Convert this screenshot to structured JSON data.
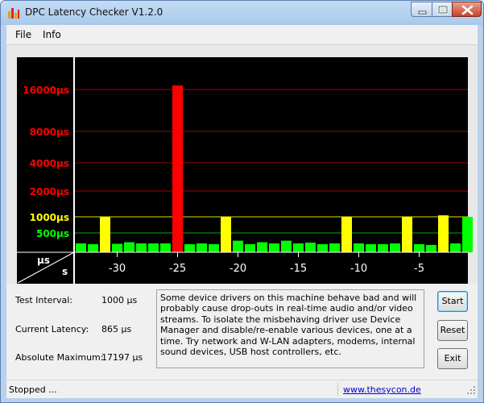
{
  "window": {
    "title": "DPC Latency Checker V1.2.0"
  },
  "menu": [
    {
      "label": "File"
    },
    {
      "label": "Info"
    }
  ],
  "chart_data": {
    "type": "bar",
    "y_unit_label": "µs",
    "x_unit_label": "s",
    "y_levels": [
      {
        "label": "16000µs",
        "value": 16000,
        "color": "#ff0000"
      },
      {
        "label": "8000µs",
        "value": 8000,
        "color": "#ff0000"
      },
      {
        "label": "4000µs",
        "value": 4000,
        "color": "#ff0000"
      },
      {
        "label": "2000µs",
        "value": 2000,
        "color": "#ff0000"
      },
      {
        "label": "1000µs",
        "value": 1000,
        "color": "#ffff00"
      },
      {
        "label": "500µs",
        "value": 500,
        "color": "#00ff00"
      }
    ],
    "x_ticks": [
      -30,
      -25,
      -20,
      -15,
      -10,
      -5
    ],
    "x_range": [
      -33,
      0
    ],
    "bar_colors": {
      "green": "#00ff00",
      "yellow": "#ffff00",
      "red": "#ff0000"
    },
    "values": [
      230,
      210,
      1000,
      220,
      260,
      230,
      230,
      230,
      17197,
      210,
      230,
      210,
      1000,
      300,
      210,
      260,
      230,
      300,
      230,
      250,
      210,
      230,
      1000,
      230,
      210,
      210,
      230,
      1000,
      210,
      190,
      1040,
      230,
      1000
    ],
    "series_colors": [
      "green",
      "green",
      "yellow",
      "green",
      "green",
      "green",
      "green",
      "green",
      "red",
      "green",
      "green",
      "green",
      "yellow",
      "green",
      "green",
      "green",
      "green",
      "green",
      "green",
      "green",
      "green",
      "green",
      "yellow",
      "green",
      "green",
      "green",
      "green",
      "yellow",
      "green",
      "green",
      "yellow",
      "green",
      "green"
    ]
  },
  "fields": {
    "test_interval": {
      "label": "Test Interval:",
      "value": "1000 µs"
    },
    "current_latency": {
      "label": "Current Latency:",
      "value": "865 µs"
    },
    "absolute_maximum": {
      "label": "Absolute Maximum:",
      "value": "17197 µs"
    }
  },
  "description": "Some device drivers on this machine behave bad and will probably cause drop-outs in real-time audio and/or video streams. To isolate the misbehaving driver use Device Manager and disable/re-enable various devices, one at a time. Try network and W-LAN adapters, modems, internal sound devices, USB host controllers, etc.",
  "buttons": {
    "start": "Start",
    "reset": "Reset",
    "exit": "Exit"
  },
  "status": {
    "text": "Stopped ...",
    "link": "www.thesycon.de"
  },
  "icons": {
    "app": "bar-chart-icon",
    "minimize": "minimize-icon",
    "maximize": "maximize-icon",
    "close": "close-icon"
  }
}
